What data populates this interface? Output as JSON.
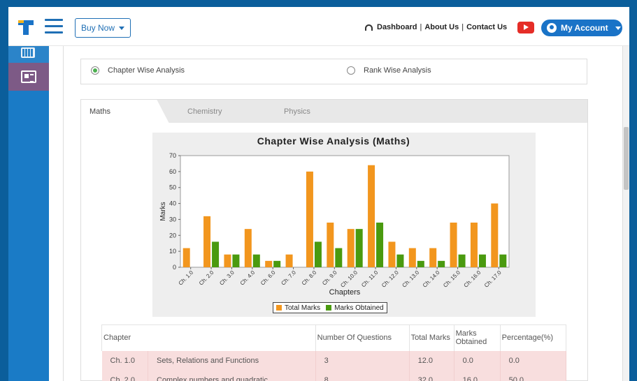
{
  "header": {
    "buy_now_label": "Buy Now",
    "nav": [
      "Dashboard",
      "About Us",
      "Contact Us"
    ],
    "account_label": "My Account"
  },
  "analysis_options": {
    "chapter_wise": "Chapter Wise Analysis",
    "rank_wise": "Rank Wise Analysis",
    "selected": "chapter_wise"
  },
  "tabs": [
    "Maths",
    "Chemistry",
    "Physics"
  ],
  "colors": {
    "total": "#f2961e",
    "obtained": "#4a9a0f",
    "accent": "#1a73c7"
  },
  "chart_data": {
    "type": "bar",
    "title": "Chapter Wise Analysis (Maths)",
    "xlabel": "Chapters",
    "ylabel": "Marks",
    "ylim": [
      0,
      70
    ],
    "yticks": [
      0,
      10,
      20,
      30,
      40,
      50,
      60,
      70
    ],
    "grid": false,
    "legend_position": "bottom",
    "categories": [
      "Ch. 1.0",
      "Ch. 2.0",
      "Ch. 3.0",
      "Ch. 4.0",
      "Ch. 6.0",
      "Ch. 7.0",
      "Ch. 8.0",
      "Ch. 9.0",
      "Ch. 10.0",
      "Ch. 11.0",
      "Ch. 12.0",
      "Ch. 13.0",
      "Ch. 14.0",
      "Ch. 15.0",
      "Ch. 16.0",
      "Ch. 17.0"
    ],
    "series": [
      {
        "name": "Total Marks",
        "values": [
          12,
          32,
          8,
          24,
          4,
          8,
          60,
          28,
          24,
          64,
          16,
          12,
          12,
          28,
          28,
          40
        ]
      },
      {
        "name": "Marks Obtained",
        "values": [
          0,
          16,
          8,
          8,
          4,
          0,
          16,
          12,
          24,
          28,
          8,
          4,
          4,
          8,
          8,
          8
        ]
      }
    ]
  },
  "table": {
    "headers": [
      "Chapter",
      "Number Of Questions",
      "Total Marks",
      "Marks Obtained",
      "Percentage(%)"
    ],
    "rows": [
      [
        "Ch. 1.0",
        "Sets, Relations and Functions",
        "3",
        "12.0",
        "0.0",
        "0.0"
      ],
      [
        "Ch. 2.0",
        "Complex numbers and quadratic",
        "8",
        "32.0",
        "16.0",
        "50.0"
      ]
    ]
  }
}
